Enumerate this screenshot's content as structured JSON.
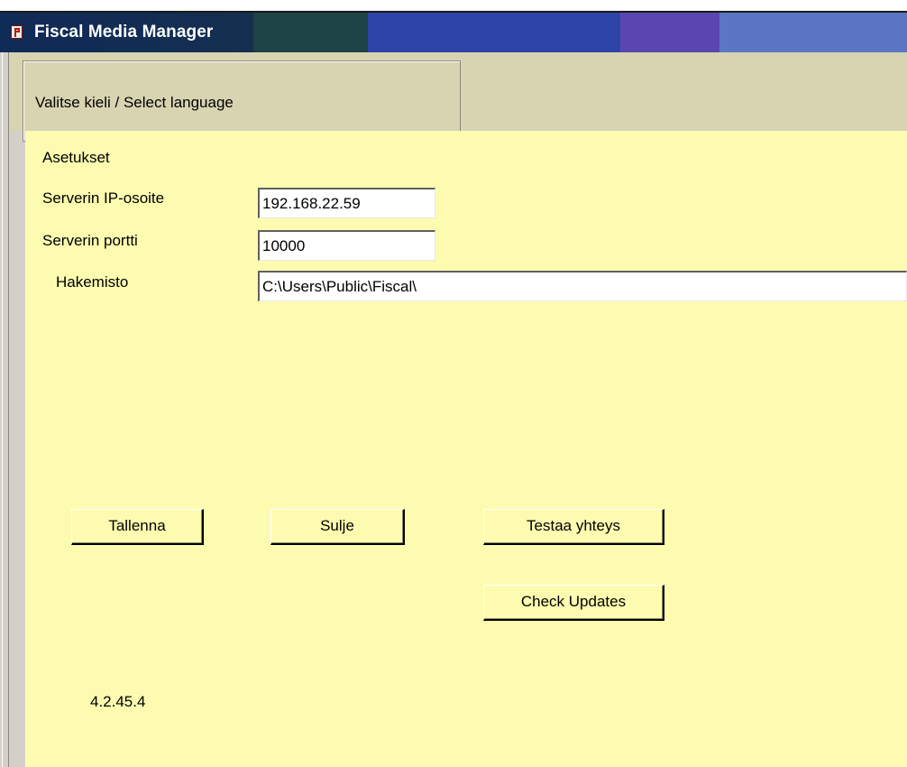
{
  "window": {
    "title": "Fiscal Media Manager"
  },
  "language_group": {
    "legend": "Valitse kieli / Select language"
  },
  "settings": {
    "heading": "Asetukset",
    "server_ip_label": "Serverin IP-osoite",
    "server_ip_value": "192.168.22.59",
    "server_port_label": "Serverin portti",
    "server_port_value": "10000",
    "directory_label": "Hakemisto",
    "directory_value": "C:\\Users\\Public\\Fiscal\\"
  },
  "buttons": {
    "save": "Tallenna",
    "close": "Sulje",
    "test_connection": "Testaa yhteys",
    "check_updates": "Check Updates"
  },
  "version": "4.2.45.4",
  "icons": {
    "app": "fiscal-app-icon"
  },
  "colors": {
    "panel_background": "#fdfbb0",
    "title_text": "#ffffff"
  }
}
